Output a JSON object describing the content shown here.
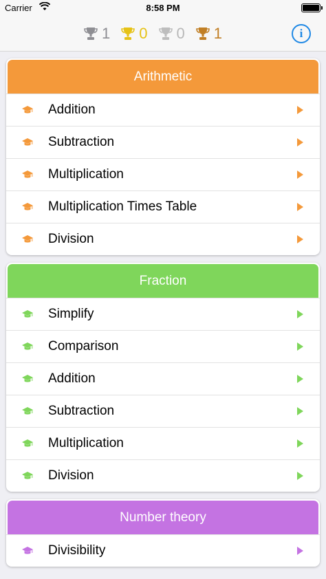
{
  "status": {
    "carrier": "Carrier",
    "time": "8:58 PM"
  },
  "trophies": [
    {
      "name": "platinum",
      "count": "1"
    },
    {
      "name": "gold",
      "count": "0"
    },
    {
      "name": "silver",
      "count": "0"
    },
    {
      "name": "bronze",
      "count": "1"
    }
  ],
  "info_label": "i",
  "colors": {
    "arithmetic": "#f4993a",
    "fraction": "#7fd65b",
    "number_theory": "#c473e2"
  },
  "sections": [
    {
      "title": "Arithmetic",
      "items": [
        "Addition",
        "Subtraction",
        "Multiplication",
        "Multiplication Times Table",
        "Division"
      ]
    },
    {
      "title": "Fraction",
      "items": [
        "Simplify",
        "Comparison",
        "Addition",
        "Subtraction",
        "Multiplication",
        "Division"
      ]
    },
    {
      "title": "Number theory",
      "items": [
        "Divisibility"
      ]
    }
  ]
}
